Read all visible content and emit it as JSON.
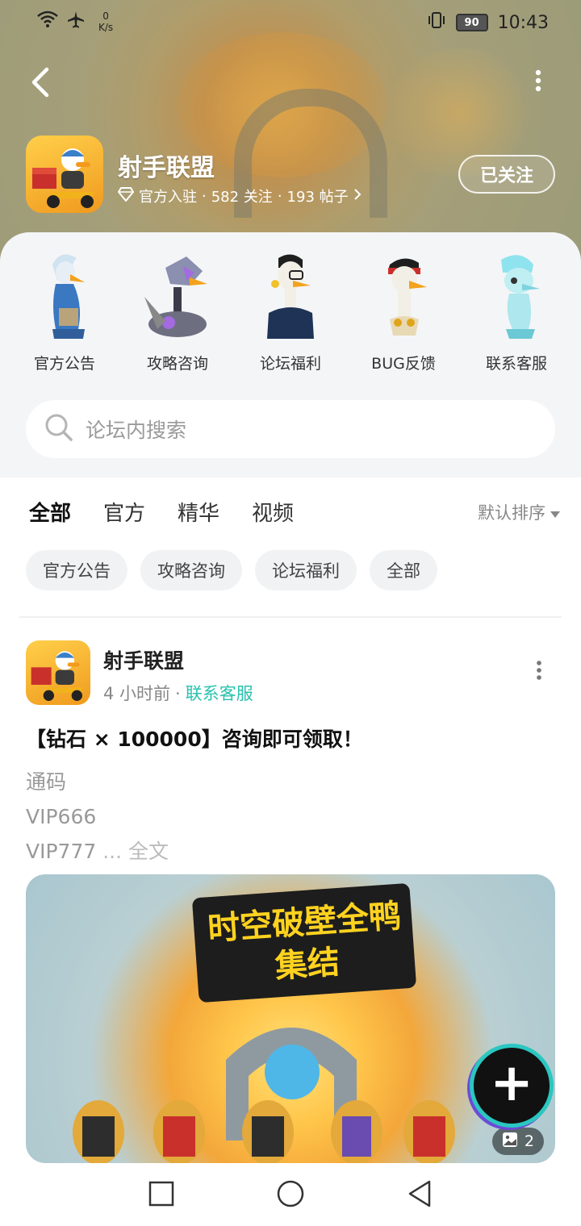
{
  "status_bar": {
    "net_speed_value": "0",
    "net_speed_unit": "K/s",
    "battery": "90",
    "time": "10:43"
  },
  "header": {
    "game_name": "射手联盟",
    "official_badge": "官方入驻",
    "follows": "582 关注",
    "posts": "193 帖子",
    "follow_button": "已关注"
  },
  "categories": [
    {
      "label": "官方公告"
    },
    {
      "label": "攻略咨询"
    },
    {
      "label": "论坛福利"
    },
    {
      "label": "BUG反馈"
    },
    {
      "label": "联系客服"
    }
  ],
  "search": {
    "placeholder": "论坛内搜索"
  },
  "tabs": [
    "全部",
    "官方",
    "精华",
    "视频"
  ],
  "sort_label": "默认排序",
  "chips": [
    "官方公告",
    "攻略咨询",
    "论坛福利",
    "全部"
  ],
  "post": {
    "author": "射手联盟",
    "time": "4 小时前",
    "category": "联系客服",
    "title": "【钻石 × 100000】咨询即可领取！",
    "body_lines": [
      "通码",
      "VIP666",
      "VIP777"
    ],
    "ellipsis": " ... ",
    "read_more": "全文",
    "image_title": "时空破壁全鸭集结",
    "image_count": "2"
  },
  "colors": {
    "accent": "#27c2ad",
    "fab_ring": "#2ac7c0"
  }
}
